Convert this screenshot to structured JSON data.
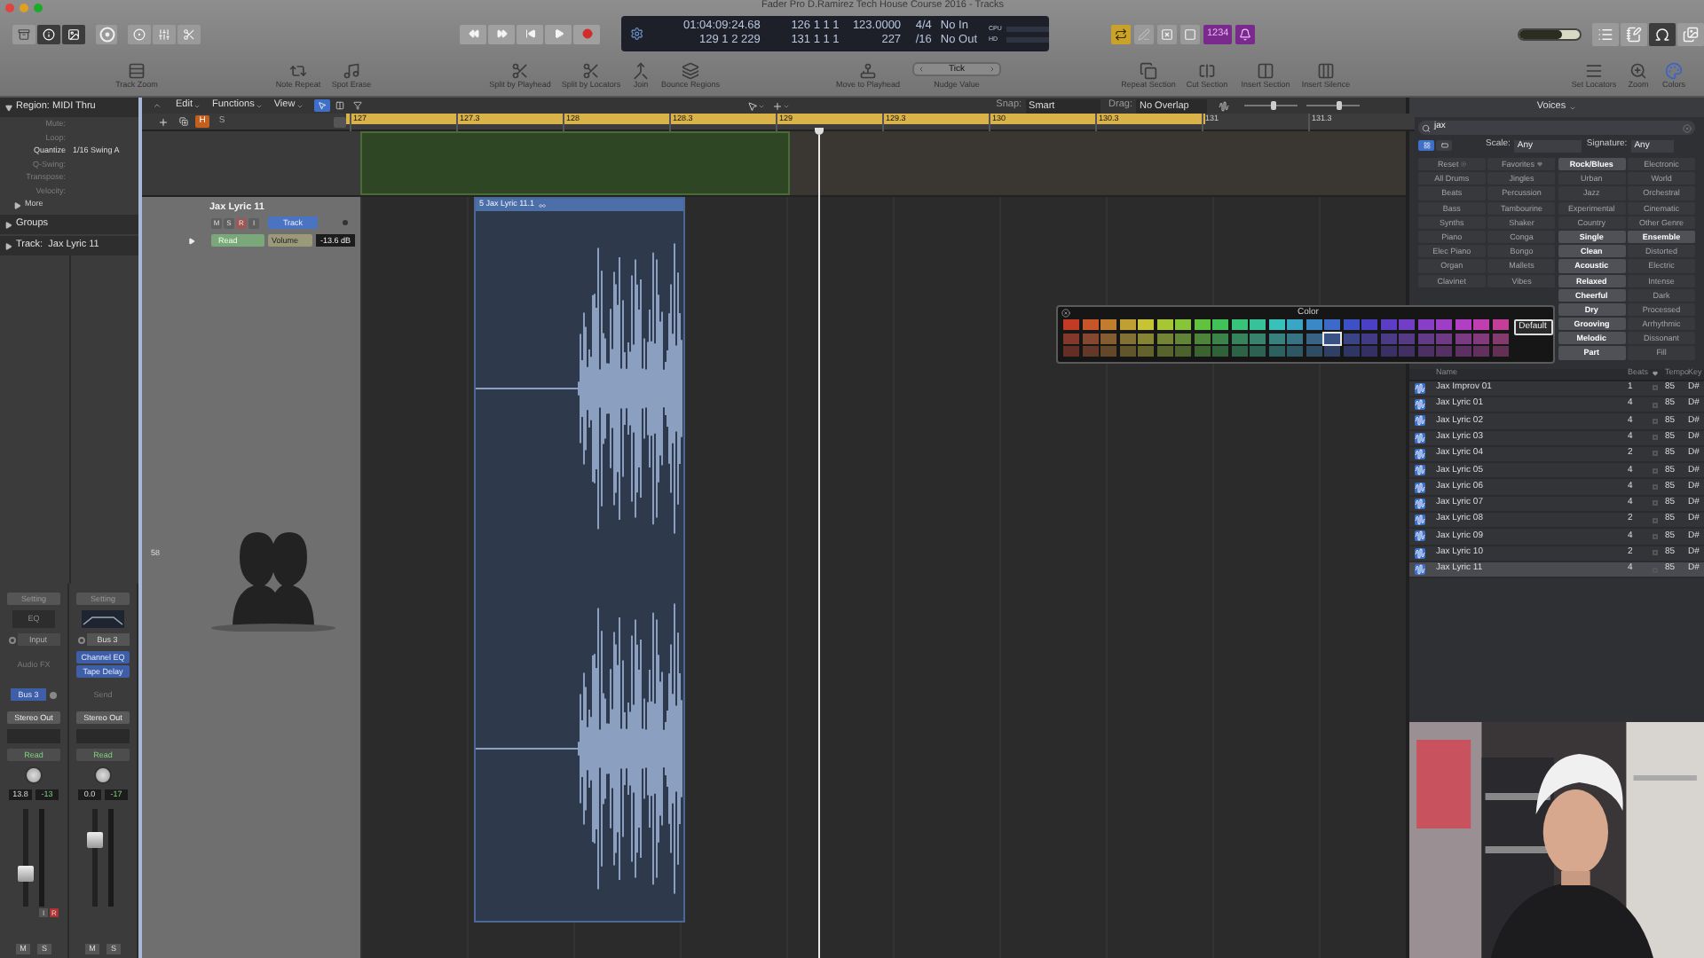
{
  "window": {
    "title": "Fader Pro D.Ramirez Tech House Course 2016 - Tracks"
  },
  "view_buttons": [
    {
      "kind": "library",
      "selected": false
    },
    {
      "kind": "inspector",
      "selected": true
    },
    {
      "kind": "browser",
      "selected": true
    }
  ],
  "control_buttons": [
    {
      "kind": "help"
    },
    {
      "kind": "smart-controls"
    },
    {
      "kind": "mixer"
    },
    {
      "kind": "editors"
    }
  ],
  "transport": [
    {
      "kind": "rewind"
    },
    {
      "kind": "forward"
    },
    {
      "kind": "to-start"
    },
    {
      "kind": "play"
    },
    {
      "kind": "record"
    }
  ],
  "lcd": {
    "time": "01:04:09:24.68",
    "position": "129 1 2 229",
    "left_locator": "126 1 1 1",
    "right_locator": "131 1 1 1",
    "tempo": "123.0000",
    "tempo_row_2": "227",
    "signature": "4/4",
    "division": "/16",
    "midi_in": "No In",
    "midi_out": "No Out",
    "cpu": "CPU",
    "hd": "HD"
  },
  "mode_buttons": [
    {
      "kind": "cycle",
      "on": true
    },
    {
      "kind": "tuner",
      "on": false
    },
    {
      "kind": "solo",
      "on": false
    },
    {
      "kind": "replace",
      "on": false
    },
    {
      "kind": "count-in",
      "label": "1234",
      "on": true
    },
    {
      "kind": "metronome",
      "on": true
    }
  ],
  "master_volume": {
    "level": 0.7
  },
  "zoom_sliders": [
    {
      "level": 0.55
    },
    {
      "level": 0.6
    }
  ],
  "window_buttons": [
    {
      "kind": "list",
      "selected": false
    },
    {
      "kind": "notes",
      "selected": false
    },
    {
      "kind": "loops",
      "selected": true
    },
    {
      "kind": "browser",
      "selected": false
    }
  ],
  "toolbar": [
    {
      "kind": "track-zoom",
      "label": "Track Zoom"
    },
    {
      "kind": "note-repeat",
      "label": "Note Repeat"
    },
    {
      "kind": "spot-erase",
      "label": "Spot Erase"
    },
    {
      "kind": "split-playhead",
      "label": "Split by Playhead"
    },
    {
      "kind": "split-locators",
      "label": "Split by Locators"
    },
    {
      "kind": "join",
      "label": "Join"
    },
    {
      "kind": "bounce",
      "label": "Bounce Regions"
    },
    {
      "kind": "move-playhead",
      "label": "Move to Playhead"
    },
    {
      "kind": "nudge",
      "label": "Nudge Value",
      "value": "Tick"
    },
    {
      "kind": "repeat-section",
      "label": "Repeat Section"
    },
    {
      "kind": "cut-section",
      "label": "Cut Section"
    },
    {
      "kind": "insert-section",
      "label": "Insert Section"
    },
    {
      "kind": "insert-silence",
      "label": "Insert Silence"
    },
    {
      "kind": "set-locators",
      "label": "Set Locators"
    },
    {
      "kind": "zoom",
      "label": "Zoom"
    },
    {
      "kind": "colors",
      "label": "Colors"
    }
  ],
  "inspector": {
    "region": {
      "title": "Region: MIDI Thru",
      "expanded": true,
      "params": [
        {
          "label": "Mute:",
          "dimmed": true
        },
        {
          "label": "Loop:",
          "dimmed": true
        },
        {
          "label": "Quantize",
          "value": "1/16 Swing A",
          "dimmed": false
        },
        {
          "label": "Q-Swing:",
          "dimmed": true
        },
        {
          "label": "Transpose:",
          "dimmed": true
        },
        {
          "label": "Velocity:",
          "dimmed": true
        }
      ],
      "more": {
        "label": "More",
        "expanded": false
      }
    },
    "groups": {
      "label": "Groups",
      "expanded": false
    },
    "track": {
      "label": "Track:  Jax Lyric 11",
      "expanded": false
    }
  },
  "channel_strips": [
    {
      "setting": "Setting",
      "eq": "EQ",
      "input": "Input",
      "inserts": [
        {
          "label": "Audio FX",
          "active": false
        }
      ],
      "send": "Bus 3",
      "send_active": true,
      "output": "Stereo Out",
      "automation": "Read",
      "volume": "13.8",
      "peak": "-13",
      "fader": {
        "level": 0.32
      },
      "extra_buttons": [
        "I",
        "R"
      ],
      "mute": "M",
      "solo": "S"
    },
    {
      "setting": "Setting",
      "input": "Bus 3",
      "inserts": [
        {
          "label": "Channel EQ",
          "active": true
        },
        {
          "label": "Tape Delay",
          "active": true
        }
      ],
      "send": "Send",
      "send_active": false,
      "output": "Stereo Out",
      "automation": "Read",
      "volume": "0.0",
      "peak": "-17",
      "fader": {
        "level": 0.68
      },
      "mute": "M",
      "solo": "S"
    }
  ],
  "arrange": {
    "menus": [
      "Edit",
      "Functions",
      "View"
    ],
    "snap_label": "Snap:",
    "snap": "Smart",
    "drag_label": "Drag:",
    "drag": "No Overlap",
    "header_buttons": [
      {
        "label": "H",
        "on": true
      },
      {
        "label": "S",
        "on": false
      }
    ],
    "ruler": [
      "127",
      "127.3",
      "128",
      "128.3",
      "129",
      "129.3",
      "130",
      "130.3",
      "131",
      "131.3"
    ],
    "track": {
      "name": "Jax Lyric 11",
      "buttons": [
        {
          "label": "M",
          "on": false
        },
        {
          "label": "S",
          "on": false
        },
        {
          "label": "R",
          "on": true
        },
        {
          "label": "I",
          "on": false
        }
      ],
      "mode": "Track",
      "automation": "Read",
      "parameter": "Volume",
      "value": "-13.6 dB",
      "number": "58"
    },
    "region": {
      "name": "5 Jax Lyric 11.1"
    }
  },
  "color_popup": {
    "title": "Color",
    "button": "Default",
    "rows": [
      {
        "swatches": [
          {
            "color": "#c23b22",
            "selected": false
          },
          {
            "color": "#c6552a",
            "selected": false
          },
          {
            "color": "#c27c2e",
            "selected": false
          },
          {
            "color": "#c0a032",
            "selected": false
          },
          {
            "color": "#c6c434",
            "selected": false
          },
          {
            "color": "#a6c634",
            "selected": false
          },
          {
            "color": "#86c43a",
            "selected": false
          },
          {
            "color": "#60c23e",
            "selected": false
          },
          {
            "color": "#40c258",
            "selected": false
          },
          {
            "color": "#38c27a",
            "selected": false
          },
          {
            "color": "#38c29c",
            "selected": false
          },
          {
            "color": "#38c0ba",
            "selected": false
          },
          {
            "color": "#38a6c4",
            "selected": false
          },
          {
            "color": "#3a88c6",
            "selected": false
          },
          {
            "color": "#3c6ac8",
            "selected": false
          },
          {
            "color": "#3e50c6",
            "selected": false
          },
          {
            "color": "#4a40c6",
            "selected": false
          },
          {
            "color": "#5c3ec6",
            "selected": false
          },
          {
            "color": "#723ec6",
            "selected": false
          },
          {
            "color": "#883ec6",
            "selected": false
          },
          {
            "color": "#9e3ec6",
            "selected": false
          },
          {
            "color": "#b23ec4",
            "selected": false
          },
          {
            "color": "#c03eb2",
            "selected": false
          },
          {
            "color": "#c23e98",
            "selected": false
          }
        ]
      },
      {
        "swatches": [
          {
            "color": "#83382b",
            "selected": false
          },
          {
            "color": "#85472f",
            "selected": false
          },
          {
            "color": "#835c31",
            "selected": false
          },
          {
            "color": "#827034",
            "selected": false
          },
          {
            "color": "#858435",
            "selected": false
          },
          {
            "color": "#738535",
            "selected": false
          },
          {
            "color": "#628438",
            "selected": false
          },
          {
            "color": "#4d833a",
            "selected": false
          },
          {
            "color": "#3b8348",
            "selected": false
          },
          {
            "color": "#37835b",
            "selected": false
          },
          {
            "color": "#37836e",
            "selected": false
          },
          {
            "color": "#37827e",
            "selected": false
          },
          {
            "color": "#377384",
            "selected": false
          },
          {
            "color": "#386385",
            "selected": false
          },
          {
            "color": "#395286",
            "selected": true
          },
          {
            "color": "#3a4485",
            "selected": false
          },
          {
            "color": "#413b85",
            "selected": false
          },
          {
            "color": "#4b3a85",
            "selected": false
          },
          {
            "color": "#573a85",
            "selected": false
          },
          {
            "color": "#633a85",
            "selected": false
          },
          {
            "color": "#6f3a85",
            "selected": false
          },
          {
            "color": "#7a3a84",
            "selected": false
          },
          {
            "color": "#823a7a",
            "selected": false
          },
          {
            "color": "#833a6c",
            "selected": false
          }
        ]
      },
      {
        "swatches": [
          {
            "color": "#622e25",
            "selected": false
          },
          {
            "color": "#633828",
            "selected": false
          },
          {
            "color": "#624729",
            "selected": false
          },
          {
            "color": "#61552b",
            "selected": false
          },
          {
            "color": "#63622c",
            "selected": false
          },
          {
            "color": "#57632c",
            "selected": false
          },
          {
            "color": "#4b622e",
            "selected": false
          },
          {
            "color": "#3c6230",
            "selected": false
          },
          {
            "color": "#306239",
            "selected": false
          },
          {
            "color": "#2d6246",
            "selected": false
          },
          {
            "color": "#2d6253",
            "selected": false
          },
          {
            "color": "#2d615f",
            "selected": false
          },
          {
            "color": "#2d5762",
            "selected": false
          },
          {
            "color": "#2e4c63",
            "selected": false
          },
          {
            "color": "#2f4064",
            "selected": false
          },
          {
            "color": "#303663",
            "selected": false
          },
          {
            "color": "#343063",
            "selected": false
          },
          {
            "color": "#3b3063",
            "selected": false
          },
          {
            "color": "#433063",
            "selected": false
          },
          {
            "color": "#4c3063",
            "selected": false
          },
          {
            "color": "#543063",
            "selected": false
          },
          {
            "color": "#5c3062",
            "selected": false
          },
          {
            "color": "#61305c",
            "selected": false
          },
          {
            "color": "#623052",
            "selected": false
          }
        ]
      }
    ]
  },
  "voices": {
    "title": "Voices",
    "search": "jax",
    "view_buttons": [
      {
        "kind": "grid",
        "selected": true
      },
      {
        "kind": "list",
        "selected": false
      }
    ],
    "scale_label": "Scale:",
    "scale": "Any",
    "signature_label": "Signature:",
    "signature": "Any",
    "keyword_rows": [
      [
        {
          "label": "Reset",
          "dimmed": true
        },
        {
          "label": "Favorites",
          "dimmed": true
        },
        {
          "label": "Rock/Blues",
          "dimmed": false
        },
        {
          "label": "Electronic",
          "dimmed": true
        }
      ],
      [
        {
          "label": "All Drums",
          "dimmed": true
        },
        {
          "label": "Jingles",
          "dimmed": true
        },
        {
          "label": "Urban",
          "dimmed": true
        },
        {
          "label": "World",
          "dimmed": true
        }
      ],
      [
        {
          "label": "Beats",
          "dimmed": true
        },
        {
          "label": "Percussion",
          "dimmed": true
        },
        {
          "label": "Jazz",
          "dimmed": true
        },
        {
          "label": "Orchestral",
          "dimmed": true
        }
      ],
      [
        {
          "label": "Bass",
          "dimmed": true
        },
        {
          "label": "Tambourine",
          "dimmed": true
        },
        {
          "label": "Experimental",
          "dimmed": true
        },
        {
          "label": "Cinematic",
          "dimmed": true
        }
      ],
      [
        {
          "label": "Synths",
          "dimmed": true
        },
        {
          "label": "Shaker",
          "dimmed": true
        },
        {
          "label": "Country",
          "dimmed": true
        },
        {
          "label": "Other Genre",
          "dimmed": true
        }
      ],
      [
        {
          "label": "Piano",
          "dimmed": true
        },
        {
          "label": "Conga",
          "dimmed": true
        },
        {
          "label": "Single",
          "dimmed": false
        },
        {
          "label": "Ensemble",
          "dimmed": false
        }
      ],
      [
        {
          "label": "Elec Piano",
          "dimmed": true
        },
        {
          "label": "Bongo",
          "dimmed": true
        },
        {
          "label": "Clean",
          "dimmed": false
        },
        {
          "label": "Distorted",
          "dimmed": true
        }
      ],
      [
        {
          "label": "Organ",
          "dimmed": true
        },
        {
          "label": "Mallets",
          "dimmed": true
        },
        {
          "label": "Acoustic",
          "dimmed": false
        },
        {
          "label": "Electric",
          "dimmed": true
        }
      ],
      [
        {
          "label": "Clavinet",
          "dimmed": true
        },
        {
          "label": "Vibes",
          "dimmed": true
        },
        {
          "label": "Relaxed",
          "dimmed": false
        },
        {
          "label": "Intense",
          "dimmed": true
        }
      ],
      [
        {
          "label": "Cheerful",
          "dimmed": false
        },
        {
          "label": "Dark",
          "dimmed": true
        }
      ],
      [
        {
          "label": "Dry",
          "dimmed": false
        },
        {
          "label": "Processed",
          "dimmed": true
        }
      ],
      [
        {
          "label": "Grooving",
          "dimmed": false
        },
        {
          "label": "Arrhythmic",
          "dimmed": true
        }
      ],
      [
        {
          "label": "Melodic",
          "dimmed": false
        },
        {
          "label": "Dissonant",
          "dimmed": true
        }
      ],
      [
        {
          "label": "Part",
          "dimmed": false
        },
        {
          "label": "Fill",
          "dimmed": true
        }
      ]
    ],
    "columns": {
      "name": "Name",
      "beats": "Beats",
      "tempo": "Tempo",
      "key": "Key"
    },
    "results": [
      {
        "name": "Jax Improv 01",
        "beats": "1",
        "tempo": "85",
        "key": "D#",
        "selected": false
      },
      {
        "name": "Jax Lyric 01",
        "beats": "4",
        "tempo": "85",
        "key": "D#",
        "selected": false
      },
      {
        "name": "Jax Lyric 02",
        "beats": "4",
        "tempo": "85",
        "key": "D#",
        "selected": false
      },
      {
        "name": "Jax Lyric 03",
        "beats": "4",
        "tempo": "85",
        "key": "D#",
        "selected": false
      },
      {
        "name": "Jax Lyric 04",
        "beats": "2",
        "tempo": "85",
        "key": "D#",
        "selected": false
      },
      {
        "name": "Jax Lyric 05",
        "beats": "4",
        "tempo": "85",
        "key": "D#",
        "selected": false
      },
      {
        "name": "Jax Lyric 06",
        "beats": "4",
        "tempo": "85",
        "key": "D#",
        "selected": false
      },
      {
        "name": "Jax Lyric 07",
        "beats": "4",
        "tempo": "85",
        "key": "D#",
        "selected": false
      },
      {
        "name": "Jax Lyric 08",
        "beats": "2",
        "tempo": "85",
        "key": "D#",
        "selected": false
      },
      {
        "name": "Jax Lyric 09",
        "beats": "4",
        "tempo": "85",
        "key": "D#",
        "selected": false
      },
      {
        "name": "Jax Lyric 10",
        "beats": "2",
        "tempo": "85",
        "key": "D#",
        "selected": false
      },
      {
        "name": "Jax Lyric 11",
        "beats": "4",
        "tempo": "85",
        "key": "D#",
        "selected": true
      }
    ]
  }
}
